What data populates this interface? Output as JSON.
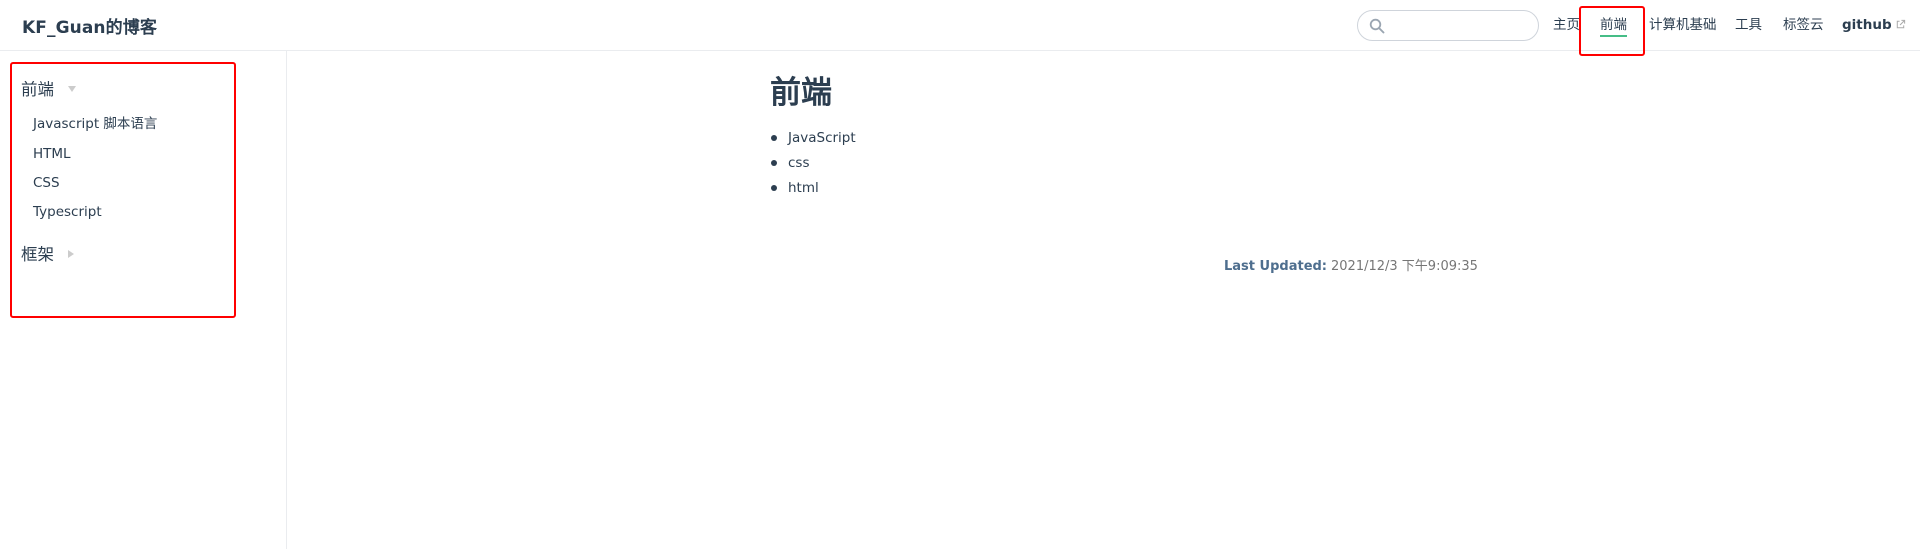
{
  "header": {
    "site_name": "KF_Guan的博客",
    "search": {
      "value": "",
      "placeholder": ""
    },
    "nav": [
      {
        "label": "主页"
      },
      {
        "label": "前端"
      },
      {
        "label": "计算机基础"
      },
      {
        "label": "工具"
      },
      {
        "label": "标签云"
      },
      {
        "label": "github"
      }
    ]
  },
  "sidebar": {
    "groups": [
      {
        "title": "前端",
        "expanded": true,
        "items": [
          {
            "label": "Javascript 脚本语言"
          },
          {
            "label": "HTML"
          },
          {
            "label": "CSS"
          },
          {
            "label": "Typescript"
          }
        ]
      },
      {
        "title": "框架",
        "expanded": false,
        "items": []
      }
    ]
  },
  "main": {
    "title": "前端",
    "list": [
      {
        "label": "JavaScript"
      },
      {
        "label": "css"
      },
      {
        "label": "html"
      }
    ],
    "last_updated": {
      "prefix": "Last Updated:",
      "value": "2021/12/3 下午9:09:35"
    }
  },
  "colors": {
    "text": "#2c3e50",
    "accent": "#46bd87",
    "border": "#eaecef",
    "highlight": "#ff0000"
  },
  "icons": {
    "search": "search-icon",
    "external": "external-link-icon",
    "expanded": "caret-down-icon",
    "collapsed": "caret-right-icon"
  }
}
